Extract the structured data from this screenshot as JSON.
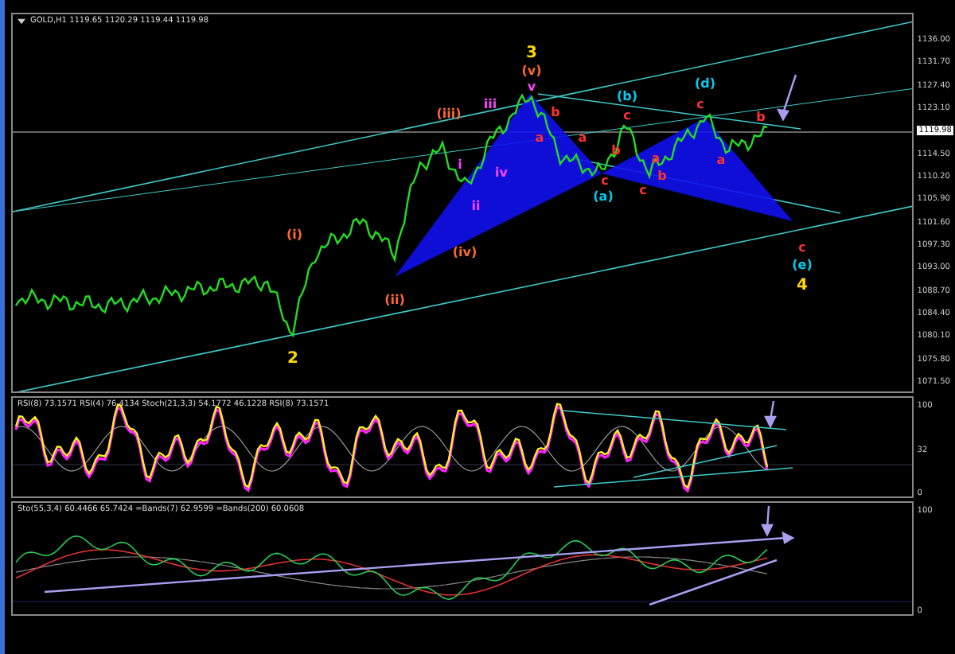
{
  "chart_header": "GOLD,H1  1119.65 1120.29 1119.44 1119.98",
  "price_axis": [
    "1136.00",
    "1131.70",
    "1127.40",
    "1123.10",
    "1114.50",
    "1110.20",
    "1105.90",
    "1101.60",
    "1097.30",
    "1093.00",
    "1088.70",
    "1084.40",
    "1080.10",
    "1075.80",
    "1071.50"
  ],
  "current_price": "1119.98",
  "wave_labels": [
    {
      "text": "3",
      "color": "#ffd700"
    },
    {
      "text": "(v)",
      "color": "#ff6a2a"
    },
    {
      "text": "v",
      "color": "#ff44ff"
    },
    {
      "text": "(iii)",
      "color": "#ff6a2a"
    },
    {
      "text": "iii",
      "color": "#ff44ff"
    },
    {
      "text": "i",
      "color": "#ff44ff"
    },
    {
      "text": "iv",
      "color": "#ff44ff"
    },
    {
      "text": "ii",
      "color": "#ff44ff"
    },
    {
      "text": "(iv)",
      "color": "#ff6a2a"
    },
    {
      "text": "(ii)",
      "color": "#ff6a2a"
    },
    {
      "text": "(i)",
      "color": "#ff6a2a"
    },
    {
      "text": "2",
      "color": "#ffd700"
    },
    {
      "text": "b",
      "color": "#ff3030"
    },
    {
      "text": "a",
      "color": "#ff3030"
    },
    {
      "text": "(b)",
      "color": "#00ccee"
    },
    {
      "text": "c",
      "color": "#ff3030"
    },
    {
      "text": "a",
      "color": "#ff3030"
    },
    {
      "text": "b",
      "color": "#ff3030"
    },
    {
      "text": "c",
      "color": "#ff3030"
    },
    {
      "text": "(a)",
      "color": "#00ccee"
    },
    {
      "text": "b",
      "color": "#ff3030"
    },
    {
      "text": "a",
      "color": "#ff3030"
    },
    {
      "text": "c",
      "color": "#ff3030"
    },
    {
      "text": "(d)",
      "color": "#00ccee"
    },
    {
      "text": "c",
      "color": "#ff3030"
    },
    {
      "text": "a",
      "color": "#ff3030"
    },
    {
      "text": "b",
      "color": "#ff3030"
    },
    {
      "text": "c",
      "color": "#ff3030"
    },
    {
      "text": "(e)",
      "color": "#00ccee"
    },
    {
      "text": "4",
      "color": "#ffd700"
    }
  ],
  "rsi_panel": {
    "header": "RSI(8) 73.1571  RSI(4) 76.4134  Stoch(21,3,3) 54.1772 46.1228  RSI(8) 73.1571",
    "axis": [
      "100",
      "32",
      "0"
    ]
  },
  "stoch_panel": {
    "header": "Sto(55,3,4) 60.4466 65.7424  =Bands(7) 62.9599  =Bands(200) 60.0608",
    "axis": [
      "100",
      "0"
    ]
  }
}
